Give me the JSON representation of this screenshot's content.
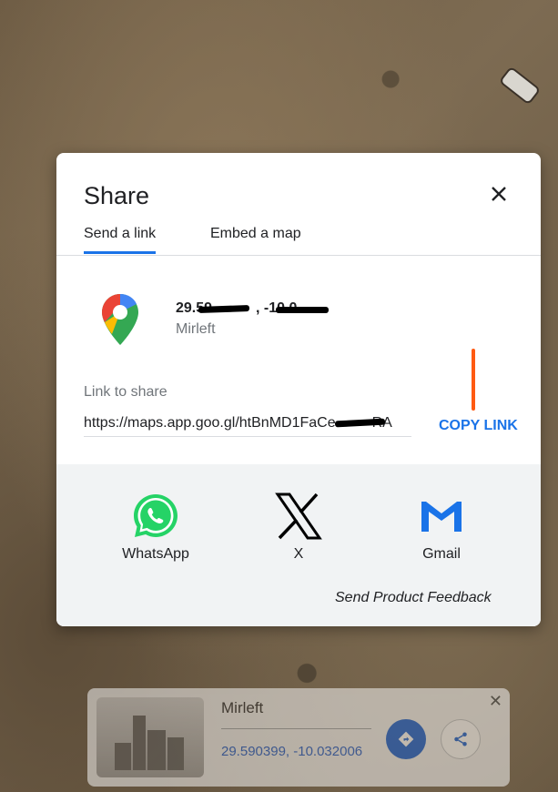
{
  "dialog": {
    "title": "Share",
    "tabs": [
      {
        "label": "Send a link",
        "active": true
      },
      {
        "label": "Embed a map",
        "active": false
      }
    ],
    "location": {
      "coords": "29.59   , -10.0    ",
      "name": "Mirleft"
    },
    "link_label": "Link to share",
    "link_url": "https://maps.app.goo.gl/htBnMD1FaCe   RA",
    "copy_label": "COPY LINK",
    "share_options": [
      {
        "label": "WhatsApp",
        "icon": "whatsapp-icon"
      },
      {
        "label": "X",
        "icon": "x-icon"
      },
      {
        "label": "Gmail",
        "icon": "gmail-icon"
      }
    ],
    "feedback": "Send Product Feedback"
  },
  "place_card": {
    "name": "Mirleft",
    "coords": "29.590399, -10.032006"
  },
  "colors": {
    "accent": "#1a73e8",
    "whatsapp": "#25d366",
    "directions": "#0b57d0",
    "redaction_orange": "#ff5a12"
  }
}
